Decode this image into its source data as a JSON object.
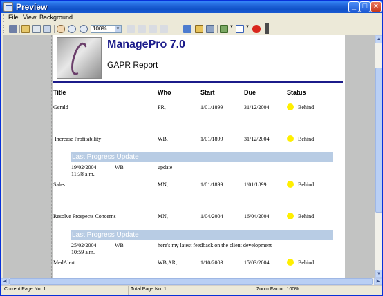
{
  "window": {
    "title": "Preview"
  },
  "menu": {
    "file": "File",
    "view": "View",
    "background": "Background"
  },
  "toolbar": {
    "zoom_value": "100%"
  },
  "report": {
    "app_name": "ManagePro 7.0",
    "report_title": "GAPR Report",
    "columns": {
      "title": "Title",
      "who": "Who",
      "start": "Start",
      "due": "Due",
      "status": "Status"
    },
    "rows": [
      {
        "title": "Gerald",
        "who": "PR,",
        "start": "1/01/1899",
        "due": "31/12/2004",
        "status": "Behind",
        "status_color": "#ffef00"
      },
      {
        "title": "Increase Profitability",
        "who": "WB,",
        "start": "1/01/1899",
        "due": "31/12/2004",
        "status": "Behind",
        "status_color": "#ffef00"
      },
      {
        "title": "Sales",
        "who": "MN,",
        "start": "1/01/1899",
        "due": "1/01/1899",
        "status": "Behind",
        "status_color": "#ffef00"
      },
      {
        "title": "Resolve Prospects Concerns",
        "who": "MN,",
        "start": "1/04/2004",
        "due": "16/04/2004",
        "status": "Behind",
        "status_color": "#ffef00"
      },
      {
        "title": "MedAlert",
        "who": "WB,AR,",
        "start": "1/10/2003",
        "due": "15/03/2004",
        "status": "Behind",
        "status_color": "#ffef00"
      }
    ],
    "progress_updates": [
      {
        "header": "Last Progress Update",
        "date": "19/02/2004",
        "time": "11:38 a.m.",
        "who": "WB",
        "text": "update"
      },
      {
        "header": "Last Progress Update",
        "date": "25/02/2004",
        "time": "10:59 a.m.",
        "who": "WB",
        "text": "here's my latest feedback on the client development"
      }
    ]
  },
  "statusbar": {
    "current_page": "Current Page No: 1",
    "total_pages": "Total Page No: 1",
    "zoom": "Zoom Factor: 100%"
  },
  "colors": {
    "accent": "#1b1b8a",
    "band": "#b8cce4",
    "status_behind": "#ffef00"
  }
}
